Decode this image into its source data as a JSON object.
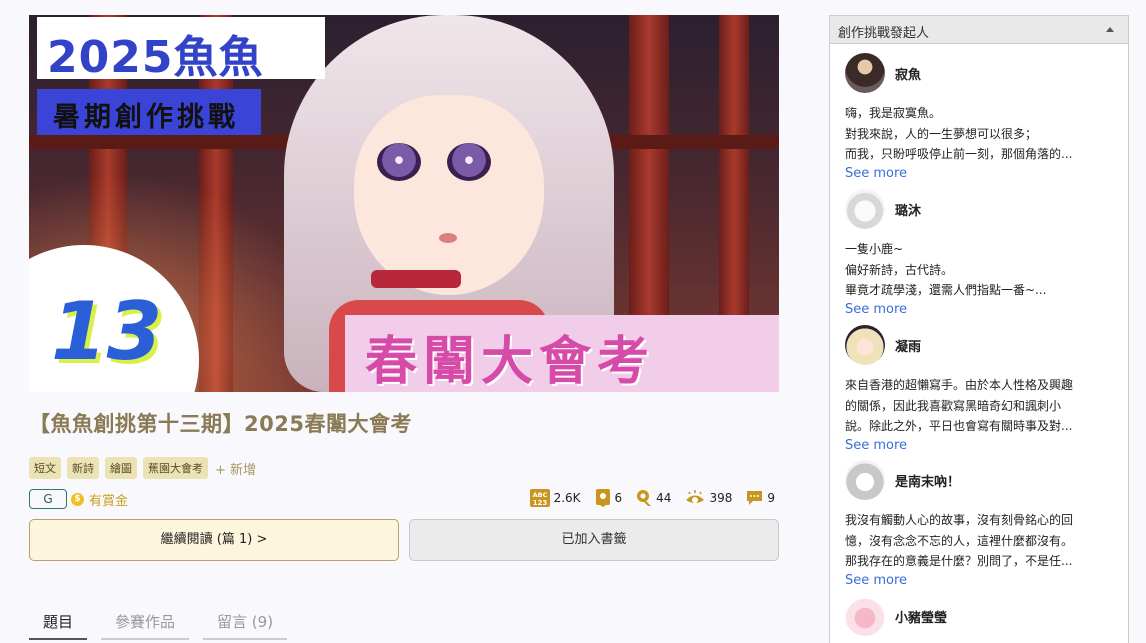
{
  "cover": {
    "year_label": "2025魚魚",
    "subtitle_label": "暑期創作挑戰",
    "issue_number": "13",
    "theme_label": "春闈大會考"
  },
  "work": {
    "title": "【魚魚創挑第十三期】2025春闈大會考",
    "tags": [
      "短文",
      "新詩",
      "繪圖",
      "蕉園大會考"
    ],
    "tag_add": "+ 新增",
    "rating": "G",
    "reward": "有賞金"
  },
  "stats": {
    "words": "2.6K",
    "chapters": "6",
    "likes": "44",
    "views": "398",
    "comments": "9"
  },
  "buttons": {
    "continue": "繼續閱讀 (篇 1) >",
    "bookmark": "已加入書籤"
  },
  "tabs": [
    {
      "label": "題目"
    },
    {
      "label": "參賽作品"
    },
    {
      "label": "留言 (9)"
    }
  ],
  "sidebar": {
    "title": "創作挑戰發起人",
    "authors": [
      {
        "name": "寂魚",
        "bio": "嗨，我是寂寞魚。\n對我來說，人的一生夢想可以很多；\n而我，只盼呼吸停止前一刻，那個角落的...",
        "more": "See more"
      },
      {
        "name": "璐沐",
        "bio": "一隻小鹿~\n偏好新詩，古代詩。\n畢竟才疏學淺，還需人們指點一番~...",
        "more": "See more"
      },
      {
        "name": "凝雨",
        "bio": "來自香港的超懶寫手。由於本人性格及興趣\n的關係，因此我喜歡寫黑暗奇幻和諷刺小\n說。除此之外，平日也會寫有關時事及對...",
        "more": "See more"
      },
      {
        "name": "是南末吶！",
        "bio": "我沒有觸動人心的故事，沒有刻骨銘心的回\n憶，沒有念念不忘的人，這裡什麼都沒有。\n那我存在的意義是什麼？別問了，不是任...",
        "more": "See more"
      },
      {
        "name": "小豬瑩瑩",
        "bio": "",
        "more": ""
      }
    ]
  },
  "colors": {
    "accent_gold": "#8a7a55",
    "tag_bg": "#ece3b4",
    "link_blue": "#3a6ed8"
  }
}
